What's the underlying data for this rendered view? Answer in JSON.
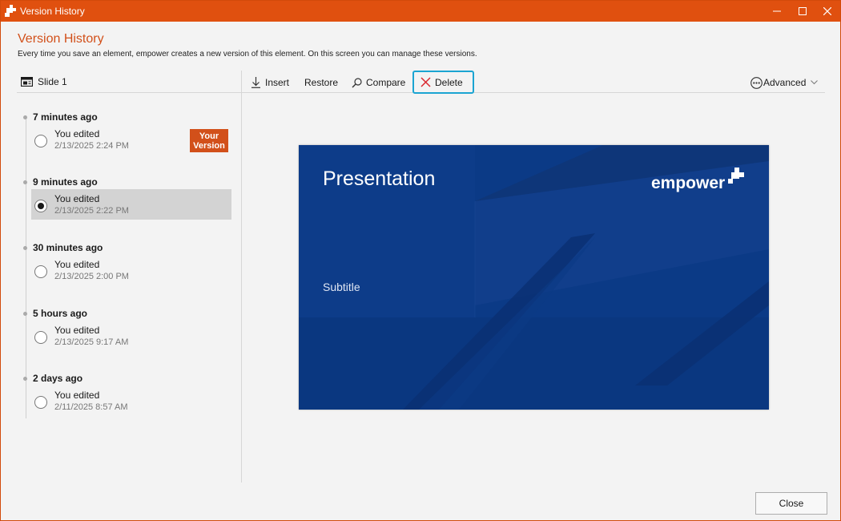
{
  "window": {
    "title": "Version History",
    "accent": "#e0500f",
    "controls": {
      "minimize": "—",
      "maximize": "☐",
      "close": "✕"
    }
  },
  "header": {
    "title": "Version History",
    "description": "Every time you save an element, empower creates a new version of this element. On this screen you can manage these versions."
  },
  "left_panel": {
    "slide_label": "Slide 1",
    "groups": [
      {
        "label": "7 minutes ago",
        "user": "You edited",
        "date": "2/13/2025 2:24 PM",
        "selected": false,
        "badge": "Your Version"
      },
      {
        "label": "9 minutes ago",
        "user": "You edited",
        "date": "2/13/2025 2:22 PM",
        "selected": true,
        "badge": ""
      },
      {
        "label": "30 minutes ago",
        "user": "You edited",
        "date": "2/13/2025 2:00 PM",
        "selected": false,
        "badge": ""
      },
      {
        "label": "5 hours ago",
        "user": "You edited",
        "date": "2/13/2025 9:17 AM",
        "selected": false,
        "badge": ""
      },
      {
        "label": "2 days ago",
        "user": "You edited",
        "date": "2/11/2025 8:57 AM",
        "selected": false,
        "badge": ""
      }
    ]
  },
  "toolbar": {
    "insert": "Insert",
    "restore": "Restore",
    "compare": "Compare",
    "delete": "Delete",
    "advanced": "Advanced"
  },
  "preview": {
    "title": "Presentation",
    "subtitle": "Subtitle",
    "logo_text": "empower",
    "background": "#0b3a86"
  },
  "footer": {
    "close": "Close"
  },
  "icons": [
    "app-logo-icon",
    "slide-icon",
    "insert-arrow-icon",
    "search-icon",
    "delete-x-icon",
    "more-icon",
    "chevron-down-icon"
  ]
}
